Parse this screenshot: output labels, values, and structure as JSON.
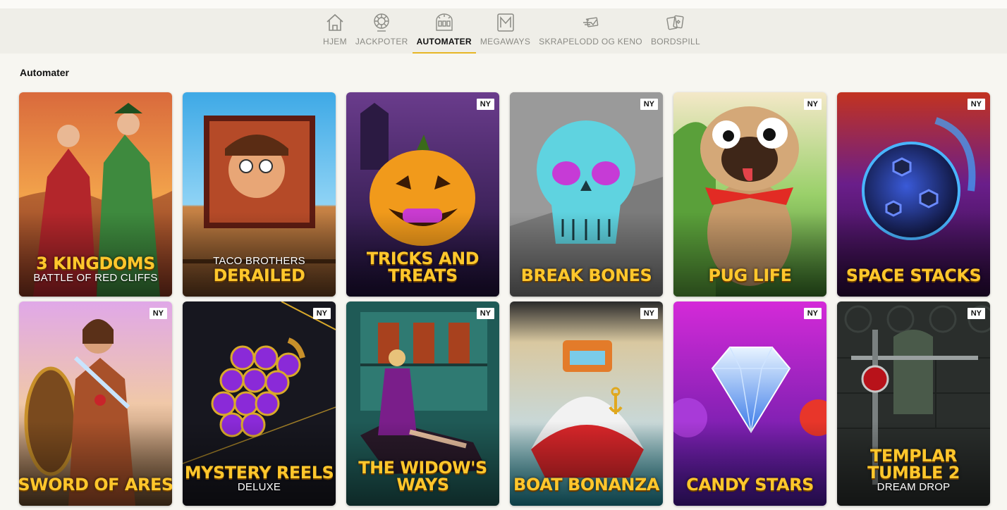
{
  "nav": {
    "items": [
      {
        "label": "HJEM",
        "icon": "home-icon"
      },
      {
        "label": "JACKPOTER",
        "icon": "jackpot-wheel-icon"
      },
      {
        "label": "AUTOMATER",
        "icon": "slot-machine-icon",
        "active": true
      },
      {
        "label": "MEGAWAYS",
        "icon": "megaways-icon"
      },
      {
        "label": "SKRAPELODD OG KENO",
        "icon": "scratch-card-icon"
      },
      {
        "label": "BORDSPILL",
        "icon": "playing-cards-icon"
      }
    ],
    "accent": "#e7b626"
  },
  "section": {
    "title": "Automater"
  },
  "badge_label": "NY",
  "colors": {
    "title_yellow": "#ffc72c",
    "background": "#f7f6f1"
  },
  "games": [
    {
      "id": "3-kingdoms",
      "name": "3 KINGDOMS",
      "subtitle": "BATTLE OF RED CLIFFS",
      "new": false
    },
    {
      "id": "taco-brothers",
      "pre": "TACO BROTHERS",
      "name": "DERAILED",
      "new": false
    },
    {
      "id": "tricks-and-treats",
      "name": "TRICKS AND",
      "name2": "TREATS",
      "new": true
    },
    {
      "id": "break-bones",
      "name": "BREAK BONES",
      "new": true
    },
    {
      "id": "pug-life",
      "name": "PUG LIFE",
      "new": true
    },
    {
      "id": "space-stacks",
      "name": "SPACE STACKS",
      "new": true
    },
    {
      "id": "sword-of-ares",
      "name": "SWORD OF ARES",
      "new": true
    },
    {
      "id": "mystery-reels",
      "name": "MYSTERY REELS",
      "subtitle": "DELUXE",
      "new": true
    },
    {
      "id": "the-widows-ways",
      "name": "THE WIDOW'S",
      "name2": "WAYS",
      "new": true
    },
    {
      "id": "boat-bonanza",
      "name": "BOAT BONANZA",
      "new": true
    },
    {
      "id": "candy-stars",
      "name": "CANDY STARS",
      "new": true
    },
    {
      "id": "templar-tumble-2",
      "name": "TEMPLAR",
      "name2": "TUMBLE 2",
      "subtitle": "DREAM DROP",
      "new": true
    }
  ]
}
